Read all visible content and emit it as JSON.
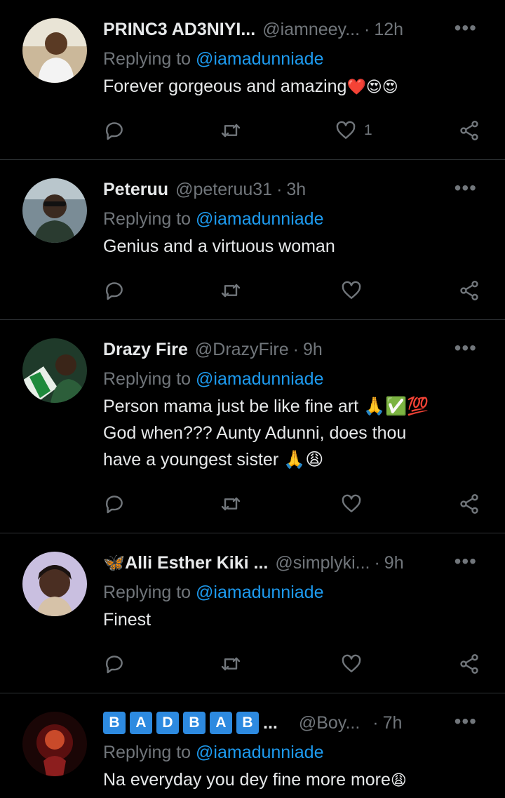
{
  "tweets": [
    {
      "name": "PRINC3 AD3NIYI...",
      "handle": "@iamneey...",
      "time": "12h",
      "replying_label": "Replying to",
      "replying_to": "@iamadunniade",
      "text": "Forever gorgeous and amazing",
      "emoji": "❤️😍😍",
      "like_count": "1"
    },
    {
      "name": "Peteruu",
      "handle": "@peteruu31",
      "time": "3h",
      "replying_label": "Replying to",
      "replying_to": "@iamadunniade",
      "text": "Genius and a virtuous woman",
      "emoji": "",
      "like_count": ""
    },
    {
      "name": "Drazy Fire",
      "handle": "@DrazyFire",
      "time": "9h",
      "replying_label": "Replying to",
      "replying_to": "@iamadunniade",
      "text": "Person mama just be like fine art 🙏✅💯\nGod when???  Aunty Adunni, does thou\nhave a youngest sister 🙏😩",
      "emoji": "",
      "like_count": ""
    },
    {
      "name": "🦋Alli Esther Kiki ...",
      "handle": "@simplyki...",
      "time": "9h",
      "replying_label": "Replying to",
      "replying_to": "@iamadunniade",
      "text": "Finest",
      "emoji": "",
      "like_count": ""
    },
    {
      "name_badges": [
        "B",
        "A",
        "D",
        "B",
        "A",
        "B"
      ],
      "name_suffix": "...",
      "handle": "@Boy...",
      "time": "7h",
      "replying_label": "Replying to",
      "replying_to": "@iamadunniade",
      "text": "Na everyday you dey fine more more",
      "emoji": "😩",
      "like_count": ""
    }
  ],
  "separator": "·",
  "more_glyph": "•••",
  "colors": {
    "background": "#000000",
    "text": "#e7e9ea",
    "muted": "#71767b",
    "link": "#1d9bf0",
    "divider": "#2f3336"
  },
  "icons": [
    "reply-icon",
    "retweet-icon",
    "like-icon",
    "share-icon",
    "more-icon"
  ]
}
